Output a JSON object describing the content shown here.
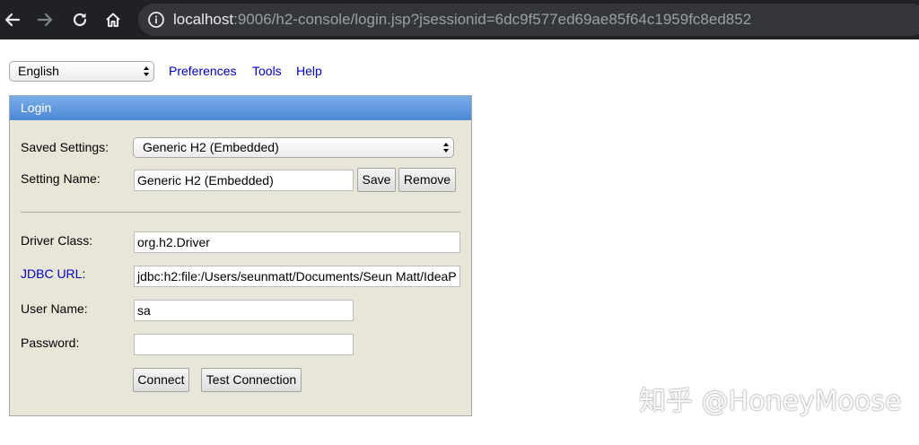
{
  "browser": {
    "url_host": "localhost",
    "url_rest": ":9006/h2-console/login.jsp?jsessionid=6dc9f577ed69ae85f64c1959fc8ed852"
  },
  "toolbar": {
    "language_value": "English",
    "links": [
      "Preferences",
      "Tools",
      "Help"
    ]
  },
  "login": {
    "header": "Login",
    "saved_settings_label": "Saved Settings:",
    "saved_settings_value": "Generic H2 (Embedded)",
    "setting_name_label": "Setting Name:",
    "setting_name_value": "Generic H2 (Embedded)",
    "save_button": "Save",
    "remove_button": "Remove",
    "driver_class_label": "Driver Class:",
    "driver_class_value": "org.h2.Driver",
    "jdbc_url_link": "JDBC URL",
    "jdbc_url_colon": ":",
    "jdbc_url_value": "jdbc:h2:file:/Users/seunmatt/Documents/Seun Matt/IdeaP",
    "user_name_label": "User Name:",
    "user_name_value": "sa",
    "password_label": "Password:",
    "password_value": "",
    "connect_button": "Connect",
    "test_connection_button": "Test Connection"
  },
  "watermark": "知乎 @HoneyMoose",
  "icons": [
    "back-arrow-icon",
    "forward-arrow-icon",
    "reload-icon",
    "home-icon",
    "info-icon",
    "select-arrows-icon"
  ],
  "colors": {
    "browser_bar": "#202124",
    "url_pill": "#35363a",
    "panel_bg": "#e8e6d9",
    "header_blue": "#5b93dd",
    "link_blue": "#0000cc"
  }
}
